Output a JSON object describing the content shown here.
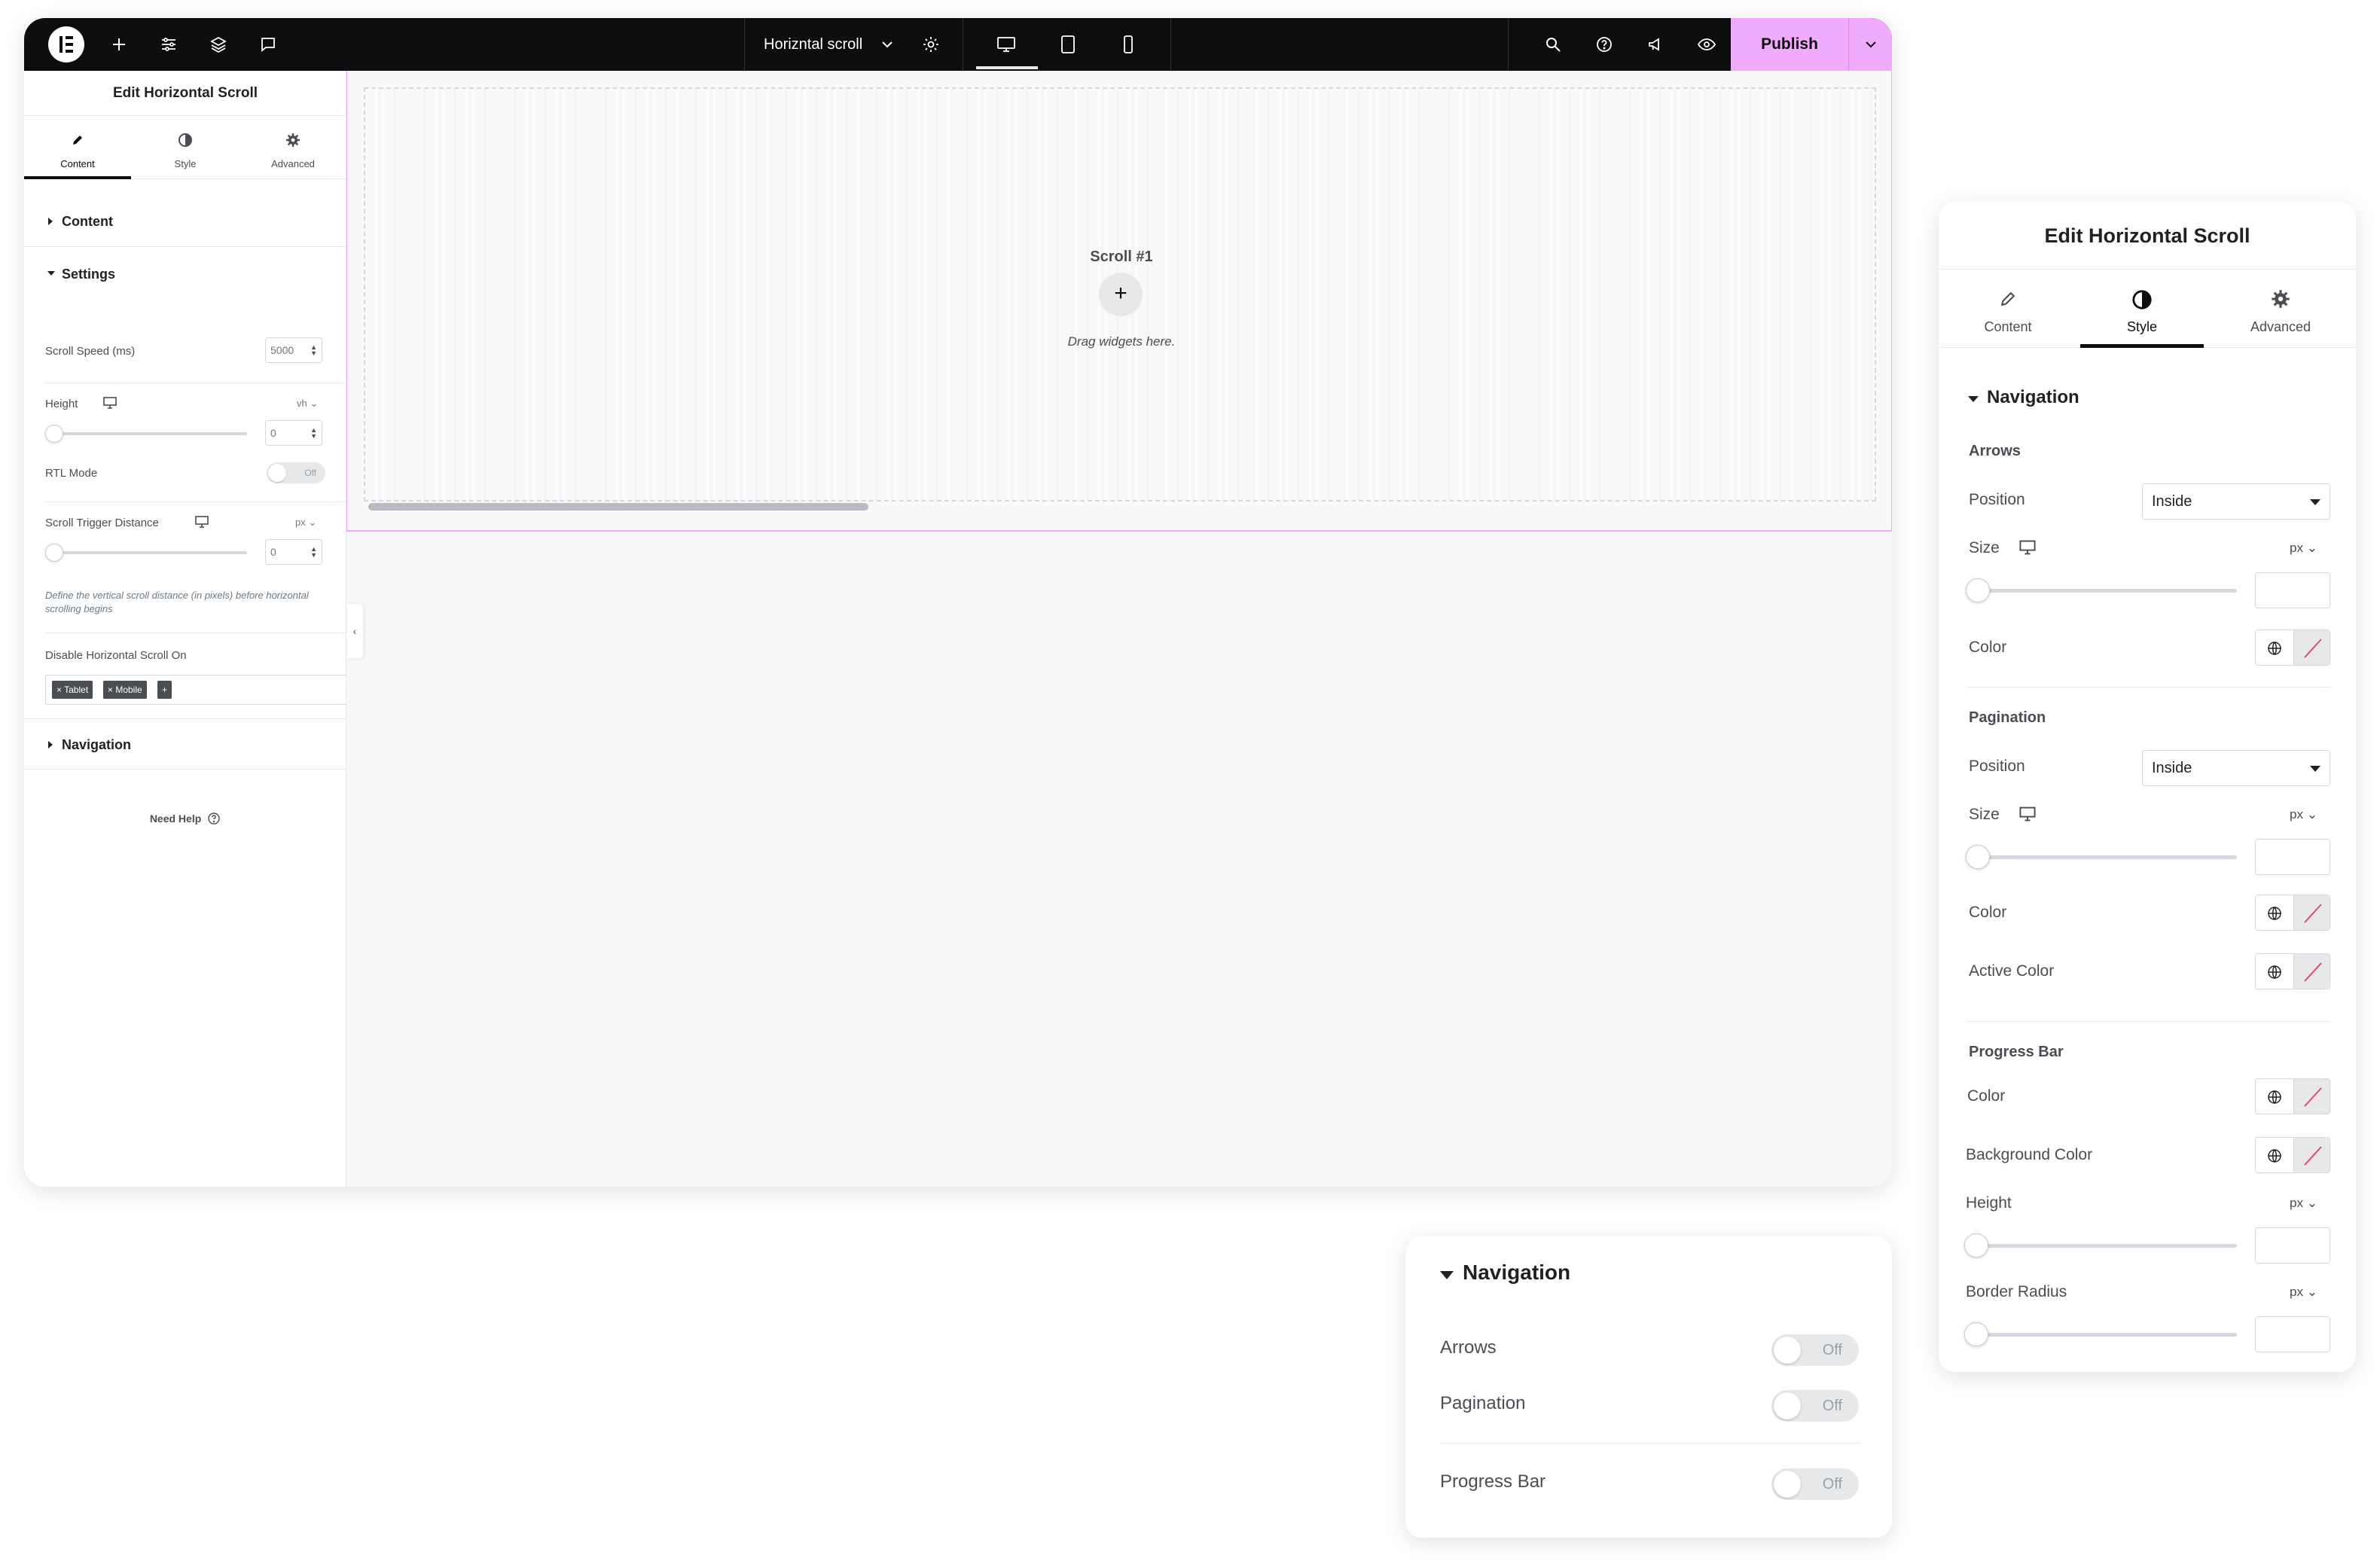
{
  "topbar": {
    "document_title": "Horizntal scroll",
    "publish_label": "Publish"
  },
  "left_panel": {
    "title": "Edit Horizontal Scroll",
    "tabs": [
      {
        "label": "Content",
        "icon": "pencil-icon",
        "active": true
      },
      {
        "label": "Style",
        "icon": "half-circle-icon",
        "active": false
      },
      {
        "label": "Advanced",
        "icon": "gear-icon",
        "active": false
      }
    ],
    "section_content": "Content",
    "section_settings": "Settings",
    "scroll_speed_label": "Scroll Speed (ms)",
    "scroll_speed_value": "5000",
    "height_label": "Height",
    "height_unit": "vh",
    "height_value": "0",
    "rtl_label": "RTL Mode",
    "rtl_state": "Off",
    "trigger_label": "Scroll Trigger Distance",
    "trigger_unit": "px",
    "trigger_value": "0",
    "trigger_help": "Define the vertical scroll distance (in pixels) before horizontal scrolling begins",
    "disable_label": "Disable Horizontal Scroll On",
    "disable_tags": [
      "× Tablet",
      "× Mobile"
    ],
    "add_tag": "+",
    "section_navigation": "Navigation",
    "need_help": "Need Help"
  },
  "canvas": {
    "scroll_label": "Scroll #1",
    "add_button": "+",
    "drag_text": "Drag widgets here."
  },
  "style_panel": {
    "title": "Edit Horizontal Scroll",
    "tabs": [
      {
        "label": "Content",
        "icon": "pencil-icon",
        "active": false
      },
      {
        "label": "Style",
        "icon": "half-circle-icon",
        "active": true
      },
      {
        "label": "Advanced",
        "icon": "gear-icon",
        "active": false
      }
    ],
    "section": "Navigation",
    "arrows": {
      "heading": "Arrows",
      "position_label": "Position",
      "position_value": "Inside",
      "size_label": "Size",
      "size_unit": "px",
      "color_label": "Color"
    },
    "pagination": {
      "heading": "Pagination",
      "position_label": "Position",
      "position_value": "Inside",
      "size_label": "Size",
      "size_unit": "px",
      "color_label": "Color",
      "active_color_label": "Active Color"
    },
    "progress_bar": {
      "heading": "Progress Bar",
      "color_label": "Color",
      "bg_color_label": "Background Color",
      "height_label": "Height",
      "height_unit": "px",
      "radius_label": "Border Radius",
      "radius_unit": "px"
    }
  },
  "nav_card": {
    "title": "Navigation",
    "rows": [
      {
        "label": "Arrows",
        "state": "Off"
      },
      {
        "label": "Pagination",
        "state": "Off"
      },
      {
        "label": "Progress Bar",
        "state": "Off"
      }
    ]
  }
}
